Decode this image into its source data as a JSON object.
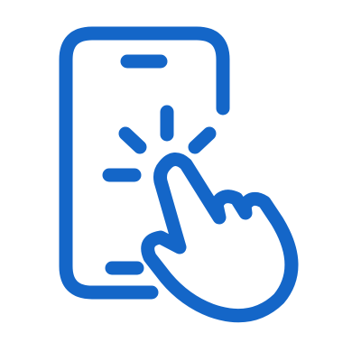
{
  "icon": {
    "name": "smartphone-tap-icon",
    "color": "#1466c8",
    "background": "#ffffff"
  }
}
